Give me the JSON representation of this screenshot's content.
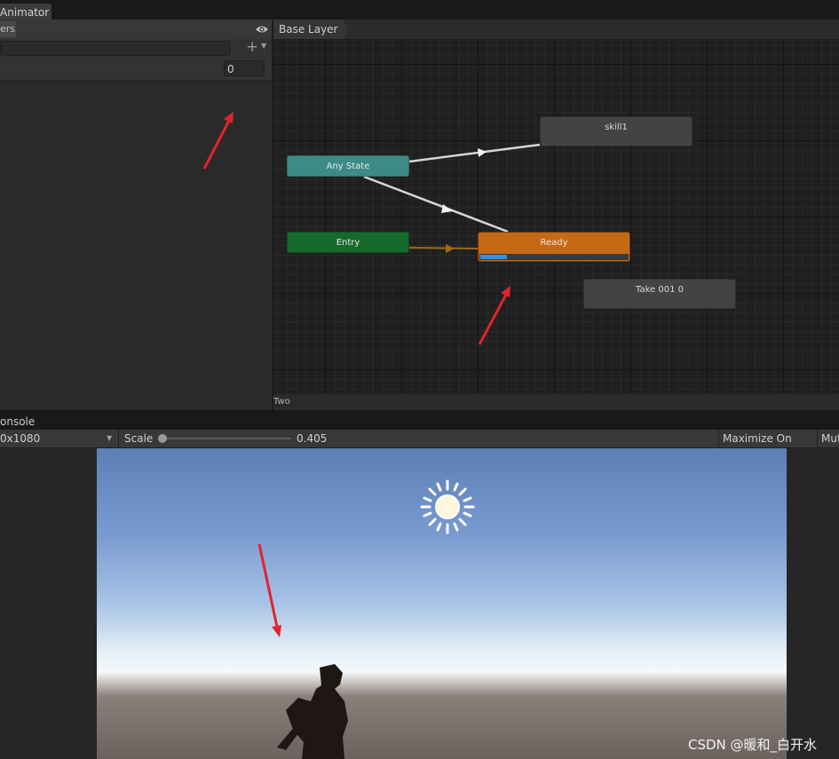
{
  "window": {
    "tab_title": "Animator"
  },
  "parameters_panel": {
    "tab_label": "ers",
    "search_placeholder": "",
    "param_value": "0"
  },
  "graph": {
    "breadcrumb": "Base Layer",
    "footer": "Two",
    "nodes": {
      "any_state": "Any State",
      "entry": "Entry",
      "skill1": "skill1",
      "ready": "Ready",
      "take": "Take 001 0"
    },
    "ready_progress": 0.18,
    "colors": {
      "any_state": "#3d8b86",
      "entry": "#176a2c",
      "ready": "#c46a15",
      "default_state": "#434343",
      "progress": "#3a8fdc"
    }
  },
  "game_panel": {
    "tab_label": "onsole",
    "resolution": "0x1080",
    "scale_label": "Scale",
    "scale_value": "0.405",
    "maximize_label": "Maximize On Play",
    "mute_label": "Mut"
  },
  "watermark": "CSDN @暖和_白开水",
  "icons": {
    "eye": "eye-icon",
    "plus": "plus-icon",
    "sun": "sun-icon"
  }
}
